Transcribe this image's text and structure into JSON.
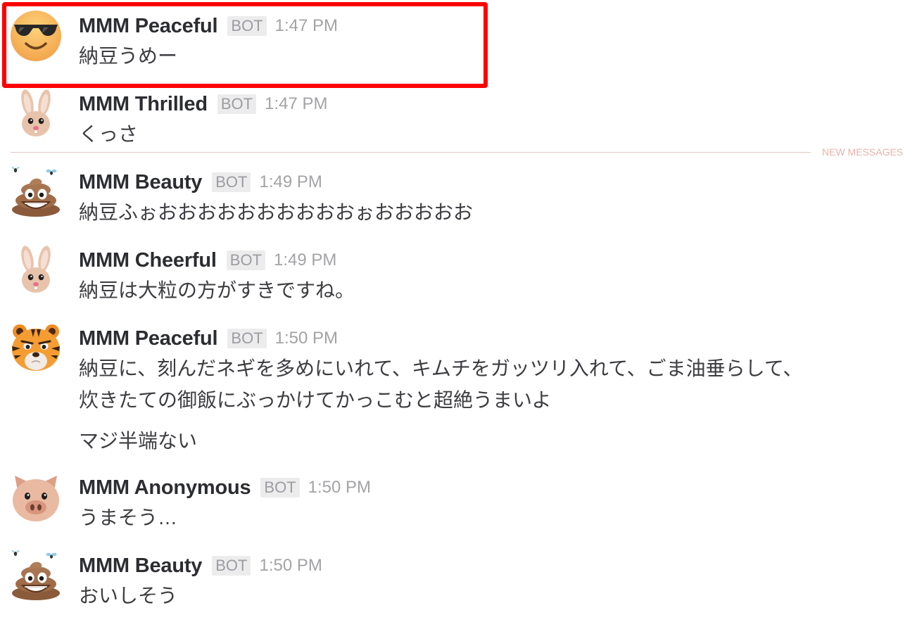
{
  "colors": {
    "sender_text": "#2c2d30",
    "message_text": "#3d3c40",
    "muted": "#a3a3a6",
    "badge_background": "#ececec",
    "new_messages": "#e8b3a8",
    "highlight": "#ff0000"
  },
  "new_messages_divider": {
    "label": "NEW MESSAGES"
  },
  "messages": [
    {
      "sender": "MMM Peaceful",
      "badge": "BOT",
      "time": "1:47 PM",
      "avatar": "sunglasses-face-icon",
      "highlighted": true,
      "lines": [
        "納豆うめー"
      ]
    },
    {
      "sender": "MMM Thrilled",
      "badge": "BOT",
      "time": "1:47 PM",
      "avatar": "rabbit-face-icon",
      "lines": [
        "くっさ"
      ]
    },
    {
      "sender": "MMM Beauty",
      "badge": "BOT",
      "time": "1:49 PM",
      "avatar": "pile-of-poo-icon",
      "lines": [
        "納豆ふぉおおおおおおおおおおぉおおおおお"
      ]
    },
    {
      "sender": "MMM Cheerful",
      "badge": "BOT",
      "time": "1:49 PM",
      "avatar": "rabbit-face-icon",
      "lines": [
        "納豆は大粒の方がすきですね。"
      ]
    },
    {
      "sender": "MMM Peaceful",
      "badge": "BOT",
      "time": "1:50 PM",
      "avatar": "tiger-face-icon",
      "lines": [
        "納豆に、刻んだネギを多めにいれて、キムチをガッツリ入れて、ごま油垂らして、",
        "炊きたての御飯にぶっかけてかっこむと超絶うまいよ"
      ],
      "followup": "マジ半端ない"
    },
    {
      "sender": "MMM Anonymous",
      "badge": "BOT",
      "time": "1:50 PM",
      "avatar": "pig-face-icon",
      "lines": [
        "うまそう…"
      ]
    },
    {
      "sender": "MMM Beauty",
      "badge": "BOT",
      "time": "1:50 PM",
      "avatar": "pile-of-poo-icon",
      "lines": [
        "おいしそう"
      ]
    }
  ]
}
